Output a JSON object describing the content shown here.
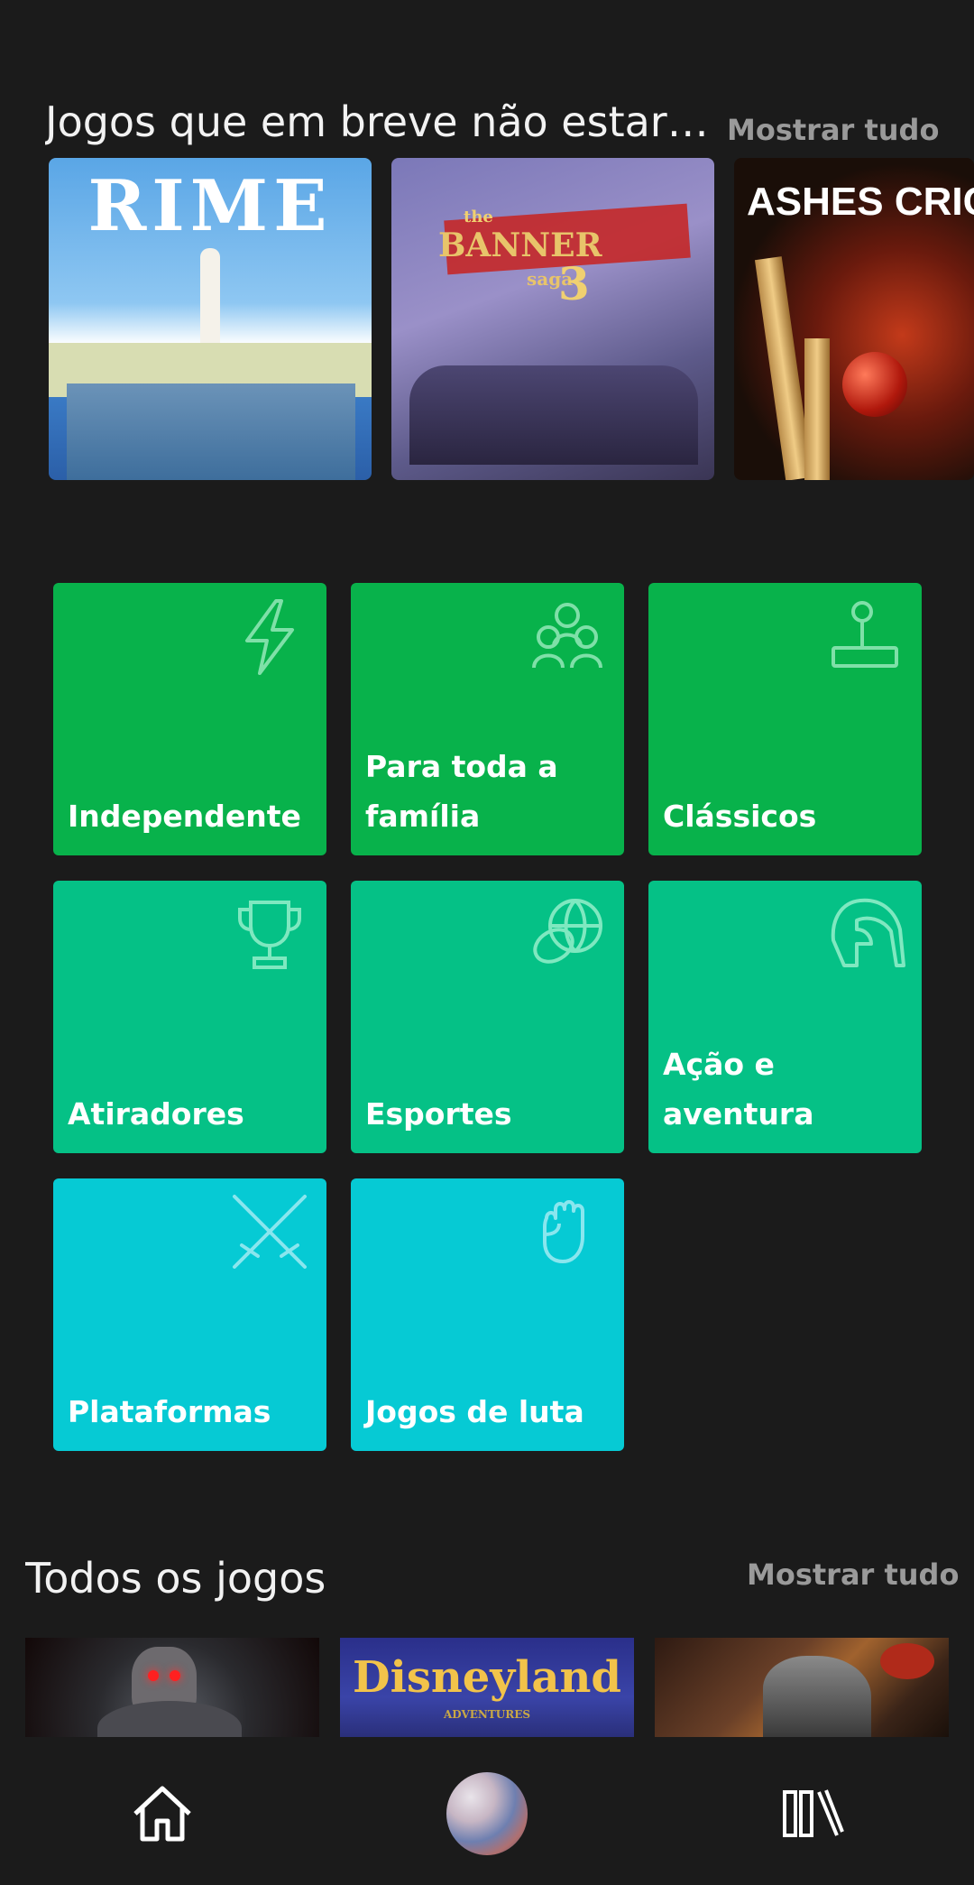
{
  "sections": {
    "leaving": {
      "title": "Jogos que em breve não estarão disponíveis",
      "show_all": "Mostrar tudo",
      "games": [
        {
          "title": "RIME",
          "icon": "rime-cover-art"
        },
        {
          "title": "The Banner Saga 3",
          "title_the": "the",
          "title_banner": "BANNER",
          "title_saga": "saga",
          "title_3": "3",
          "icon": "banner-saga-cover-art"
        },
        {
          "title": "ASHES CRIC",
          "icon": "ashes-cricket-cover-art"
        }
      ]
    },
    "all_games": {
      "title": "Todos os jogos",
      "show_all": "Mostrar tudo",
      "thumbs": [
        {
          "title": "",
          "icon": "ogre-game-thumbnail"
        },
        {
          "title": "Disneyland",
          "subtitle": "ADVENTURES",
          "icon": "disneyland-adventures-thumbnail"
        },
        {
          "title": "",
          "icon": "warrior-game-thumbnail"
        }
      ]
    }
  },
  "categories": [
    {
      "label": "Independente",
      "icon": "lightning-icon",
      "color": "#08b24b"
    },
    {
      "label": "Para toda a família",
      "icon": "group-icon",
      "color": "#08b24b"
    },
    {
      "label": "Clássicos",
      "icon": "joystick-icon",
      "color": "#08b24b"
    },
    {
      "label": "Atiradores",
      "icon": "trophy-icon",
      "color": "#05c186"
    },
    {
      "label": "Esportes",
      "icon": "sports-ball-icon",
      "color": "#05c186"
    },
    {
      "label": "Ação e aventura",
      "icon": "spartan-helmet-icon",
      "color": "#05c186"
    },
    {
      "label": "Plataformas",
      "icon": "crossed-swords-icon",
      "color": "#06cad4"
    },
    {
      "label": "Jogos de luta",
      "icon": "fist-icon",
      "color": "#06cad4"
    }
  ],
  "nav": {
    "home": {
      "icon": "home-icon"
    },
    "profile": {
      "icon": "avatar"
    },
    "library": {
      "icon": "library-icon"
    }
  }
}
